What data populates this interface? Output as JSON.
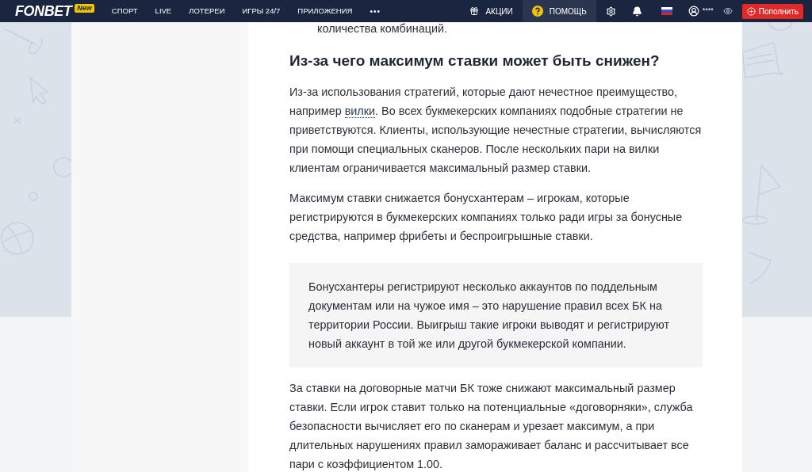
{
  "nav": {
    "logo": "FONBET",
    "logo_badge": "New",
    "items": [
      {
        "label": "СПОРТ",
        "selected": false
      },
      {
        "label": "LIVE",
        "selected": false
      },
      {
        "label": "ЛОТЕРЕИ",
        "selected": false
      },
      {
        "label": "ИГРЫ 24/7",
        "selected": false
      },
      {
        "label": "ПРИЛОЖЕНИЯ",
        "selected": false
      }
    ],
    "more": "•••",
    "promo": {
      "label": "АКЦИИ",
      "selected": false
    },
    "help": {
      "label": "ПОМОЩЬ",
      "selected": true
    },
    "balance": "****",
    "deposit": "Пополнить"
  },
  "article": {
    "cut_item": "количества комбинаций.",
    "heading": "Из-за чего максимум ставки может быть снижен?",
    "blocks": [
      {
        "kind": "paragraph",
        "parts": [
          {
            "text": "Из-за использования стратегий, которые дают нечестное преимущество, например "
          },
          {
            "text": "вилки",
            "kind": "link"
          },
          {
            "text": ". Во всех букмекерских компаниях подобные стратегии не приветствуются. Клиенты, использующие нечестные стратегии, вычисляются при помощи специальных сканеров. После нескольких пари на вилки клиентам ограничивается максимальный размер ставки."
          }
        ]
      },
      {
        "kind": "paragraph",
        "parts": [
          {
            "text": "Максимум ставки снижается бонусхантерам – игрокам, которые регистрируются в букмекерских компаниях только ради игры за бонусные средства, например фрибеты и беспроигрышные ставки."
          }
        ]
      },
      {
        "kind": "quote",
        "parts": [
          {
            "text": "Бонусхантеры регистрируют несколько аккаунтов по поддельным документам или на чужое имя – это нарушение правил всех БК на территории России. Выигрыш такие игроки выводят и регистрируют новый аккаунт в той же или другой букмекерской компании."
          }
        ]
      },
      {
        "kind": "paragraph",
        "parts": [
          {
            "text": "За ставки на договорные матчи БК тоже снижают максимальный размер ставки. Если игрок ставит только на потенциальные «договорняки», служба безопасности вычисляет его по сканерам и урезает максимум, а при длительных нарушениях правил замораживает баланс и рассчитывает все пари с коэффициентом 1.00."
          }
        ]
      }
    ]
  }
}
